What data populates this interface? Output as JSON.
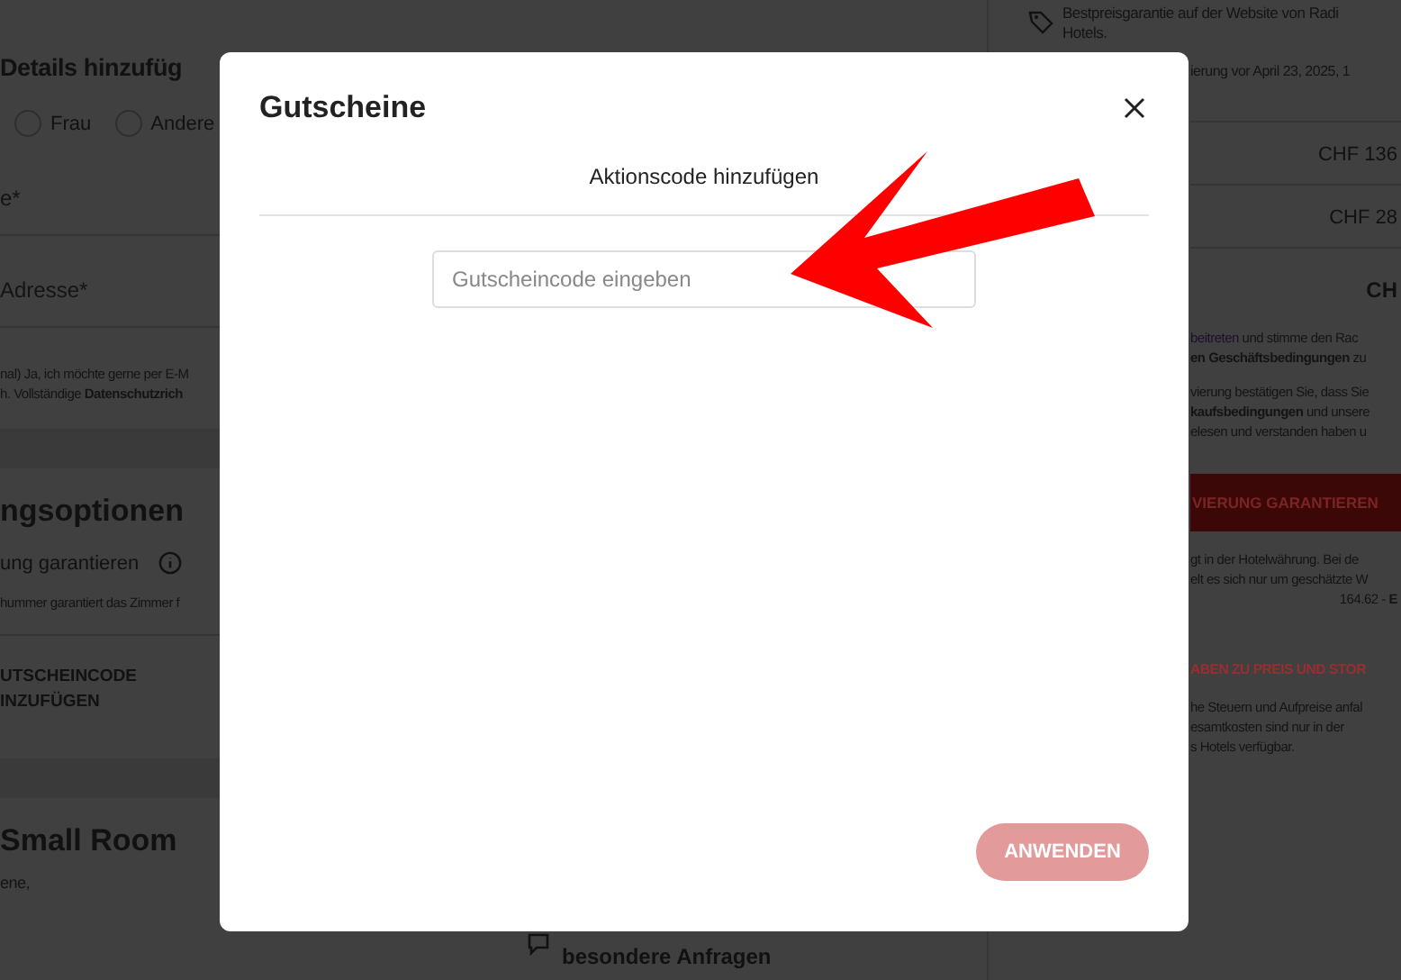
{
  "background": {
    "left": {
      "heading": "Details hinzufüg",
      "salutation": [
        {
          "label": "Frau",
          "selected": false
        },
        {
          "label": "Andere",
          "selected": false
        }
      ],
      "fields": [
        {
          "placeholder": "e*"
        },
        {
          "placeholder": "Adresse*"
        }
      ],
      "consent": [
        "nal) Ja, ich möchte gerne per E-M",
        "h. Vollständige **Datenschutzrich**"
      ],
      "options_heading": "ngsoptionen",
      "guarantee": "ung garantieren",
      "guarantee_note": "hummer garantiert das Zimmer f",
      "voucher_link": [
        "UTSCHEINCODE",
        "INZUFÜGEN"
      ],
      "room_title": "Small Room",
      "room_note": "ene,"
    },
    "requests": "besondere Anfragen",
    "summary": {
      "price_guarantee": [
        "Bestpreisgarantie auf der Website von Radi",
        "Hotels."
      ],
      "cancellation": "ierung vor April 23, 2025, 1",
      "prices": [
        "CHF 136",
        "CHF 28"
      ],
      "total": "CH",
      "join_link": "beitreten",
      "join_rest": "und stimme den Rac",
      "terms": [
        "**en Geschäftsbedingungen** zu"
      ],
      "confirm": [
        "vierung bestätigen Sie, dass Sie",
        "**kaufsbedingungen** und unsere",
        "elesen und verstanden haben u"
      ],
      "guarantee_button": "VIERUNG GARANTIEREN",
      "currency_note": [
        "gt in der Hotelwährung. Bei de",
        "elt es sich nur um geschätzte W"
      ],
      "estimate": "164.62 - **E**",
      "details_link": "ABEN ZU PREIS UND STOR",
      "tax_note": [
        "he Steuern und Aufpreise anfal",
        "esamtkosten sind nur in der",
        "s Hotels verfügbar."
      ]
    }
  },
  "dialog": {
    "title": "Gutscheine",
    "tabs": [
      {
        "label": "Aktionscode hinzufügen",
        "selected": true
      }
    ],
    "code_field": {
      "placeholder": "Gutscheincode eingeben"
    },
    "apply_button": {
      "label": "ANWENDEN",
      "disabled": true
    }
  }
}
